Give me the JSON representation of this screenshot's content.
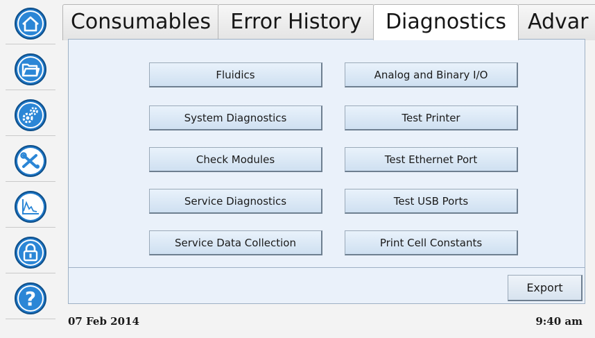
{
  "sidebar": {
    "items": [
      {
        "icon": "home-icon"
      },
      {
        "icon": "folder-icon"
      },
      {
        "icon": "gears-icon"
      },
      {
        "icon": "tools-icon"
      },
      {
        "icon": "chart-icon"
      },
      {
        "icon": "lock-icon"
      },
      {
        "icon": "help-icon"
      }
    ],
    "accent": "#1f78c8"
  },
  "tabs": [
    {
      "label": "Consumables",
      "active": false
    },
    {
      "label": "Error History",
      "active": false
    },
    {
      "label": "Diagnostics",
      "active": true
    },
    {
      "label": "Advar",
      "active": false
    }
  ],
  "diagnostics": {
    "left_buttons": [
      "Fluidics",
      "System Diagnostics",
      "Check Modules",
      "Service Diagnostics",
      "Service Data Collection"
    ],
    "right_buttons": [
      "Analog and Binary I/O",
      "Test Printer",
      "Test Ethernet Port",
      "Test USB Ports",
      "Print Cell Constants"
    ]
  },
  "export_label": "Export",
  "status": {
    "date": "07 Feb 2014",
    "time": "9:40 am"
  }
}
